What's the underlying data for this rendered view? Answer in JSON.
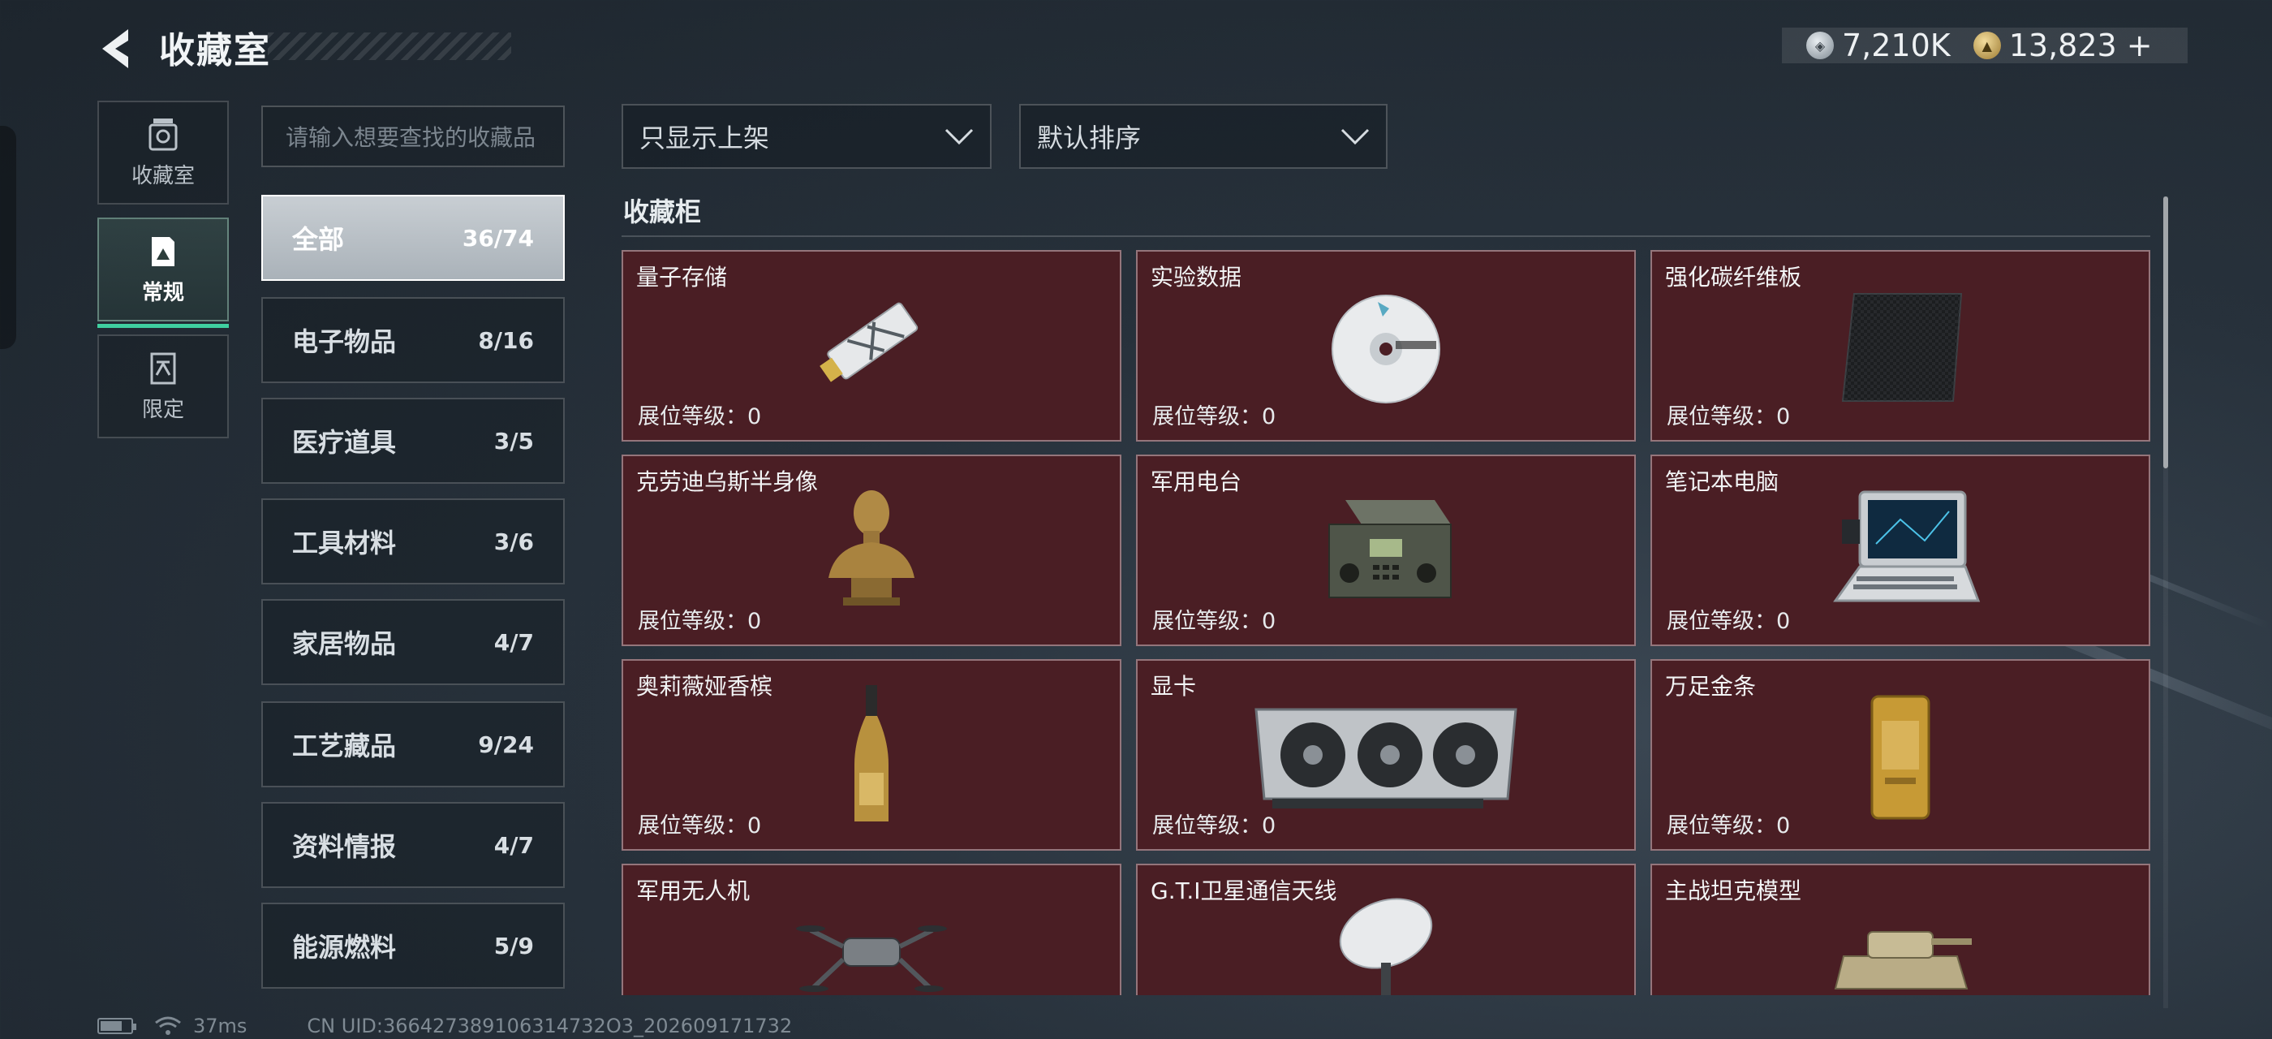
{
  "header": {
    "title": "收藏室",
    "currencies": [
      {
        "icon": "silver-coin-icon",
        "value": "7,210K"
      },
      {
        "icon": "gold-coin-icon",
        "value": "13,823"
      }
    ],
    "add_symbol": "+"
  },
  "left_nav": [
    {
      "label": "收藏室",
      "icon": "vault-icon",
      "active": false
    },
    {
      "label": "常规",
      "icon": "regular-card-icon",
      "active": true
    },
    {
      "label": "限定",
      "icon": "limited-card-icon",
      "active": false
    }
  ],
  "search": {
    "placeholder": "请输入想要查找的收藏品"
  },
  "categories": [
    {
      "name": "全部",
      "count": "36/74",
      "active": true
    },
    {
      "name": "电子物品",
      "count": "8/16"
    },
    {
      "name": "医疗道具",
      "count": "3/5"
    },
    {
      "name": "工具材料",
      "count": "3/6"
    },
    {
      "name": "家居物品",
      "count": "4/7"
    },
    {
      "name": "工艺藏品",
      "count": "9/24"
    },
    {
      "name": "资料情报",
      "count": "4/7"
    },
    {
      "name": "能源燃料",
      "count": "5/9"
    }
  ],
  "filters": {
    "display_filter": "只显示上架",
    "sort": "默认排序"
  },
  "section": {
    "title": "收藏柜"
  },
  "level_label": "展位等级：",
  "items": [
    {
      "name": "量子存储",
      "level": "0",
      "icon": "usb-drive-icon"
    },
    {
      "name": "实验数据",
      "level": "0",
      "icon": "disc-icon"
    },
    {
      "name": "强化碳纤维板",
      "level": "0",
      "icon": "carbon-plate-icon"
    },
    {
      "name": "克劳迪乌斯半身像",
      "level": "0",
      "icon": "bust-statue-icon"
    },
    {
      "name": "军用电台",
      "level": "0",
      "icon": "radio-icon"
    },
    {
      "name": "笔记本电脑",
      "level": "0",
      "icon": "laptop-icon"
    },
    {
      "name": "奥莉薇娅香槟",
      "level": "0",
      "icon": "champagne-bottle-icon"
    },
    {
      "name": "显卡",
      "level": "0",
      "icon": "graphics-card-icon"
    },
    {
      "name": "万足金条",
      "level": "0",
      "icon": "gold-bar-icon"
    },
    {
      "name": "军用无人机",
      "level": "",
      "icon": "drone-icon"
    },
    {
      "name": "G.T.I卫星通信天线",
      "level": "",
      "icon": "satellite-dish-icon"
    },
    {
      "name": "主战坦克模型",
      "level": "",
      "icon": "tank-model-icon"
    }
  ],
  "status": {
    "ping": "37ms",
    "uid": "CN UID:366427389106314732O3_202609171732"
  }
}
